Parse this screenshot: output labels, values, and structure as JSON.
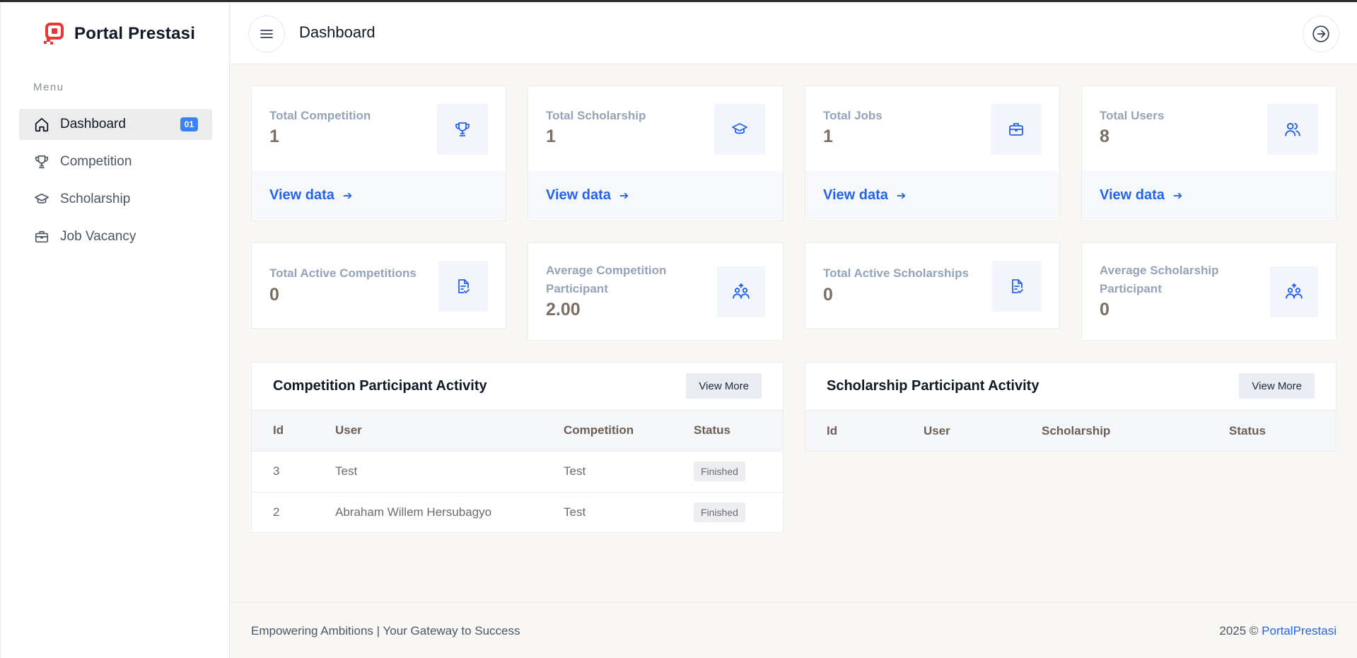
{
  "app": {
    "brand_name": "Portal Prestasi"
  },
  "sidebar": {
    "menu_label": "Menu",
    "items": [
      {
        "label": "Dashboard",
        "badge": "01",
        "icon": "home-icon",
        "active": true
      },
      {
        "label": "Competition",
        "icon": "trophy-icon"
      },
      {
        "label": "Scholarship",
        "icon": "graduation-cap-icon"
      },
      {
        "label": "Job Vacancy",
        "icon": "briefcase-icon"
      }
    ]
  },
  "header": {
    "title": "Dashboard"
  },
  "stats": [
    {
      "label": "Total Competition",
      "value": "1",
      "link": "View data",
      "icon": "trophy-icon"
    },
    {
      "label": "Total Scholarship",
      "value": "1",
      "link": "View data",
      "icon": "graduation-cap-icon"
    },
    {
      "label": "Total Jobs",
      "value": "1",
      "link": "View data",
      "icon": "briefcase-icon"
    },
    {
      "label": "Total Users",
      "value": "8",
      "link": "View data",
      "icon": "users-icon"
    }
  ],
  "stats2": [
    {
      "label": "Total Active Competitions",
      "value": "0",
      "icon": "document-check-icon"
    },
    {
      "label_line1": "Average Competition",
      "label_line2": "Participant",
      "value": "2.00",
      "icon": "participants-icon"
    },
    {
      "label": "Total Active Scholarships",
      "value": "0",
      "icon": "document-check-icon"
    },
    {
      "label_line1": "Average Scholarship",
      "label_line2": "Participant",
      "value": "0",
      "icon": "participants-icon"
    }
  ],
  "competition_activity": {
    "title": "Competition Participant Activity",
    "view_more": "View More",
    "columns": [
      "Id",
      "User",
      "Competition",
      "Status"
    ],
    "rows": [
      {
        "id": "3",
        "user": "Test",
        "competition": "Test",
        "status": "Finished"
      },
      {
        "id": "2",
        "user": "Abraham Willem Hersubagyo",
        "competition": "Test",
        "status": "Finished"
      }
    ]
  },
  "scholarship_activity": {
    "title": "Scholarship Participant Activity",
    "view_more": "View More",
    "columns": [
      "Id",
      "User",
      "Scholarship",
      "Status"
    ],
    "rows": []
  },
  "footer": {
    "tagline": "Empowering Ambitions | Your Gateway to Success",
    "copyright": "2025 ©",
    "link_text": "PortalPrestasi"
  },
  "colors": {
    "accent": "#2563eb",
    "brand_red": "#e53935",
    "badge": "#3b82f6"
  }
}
